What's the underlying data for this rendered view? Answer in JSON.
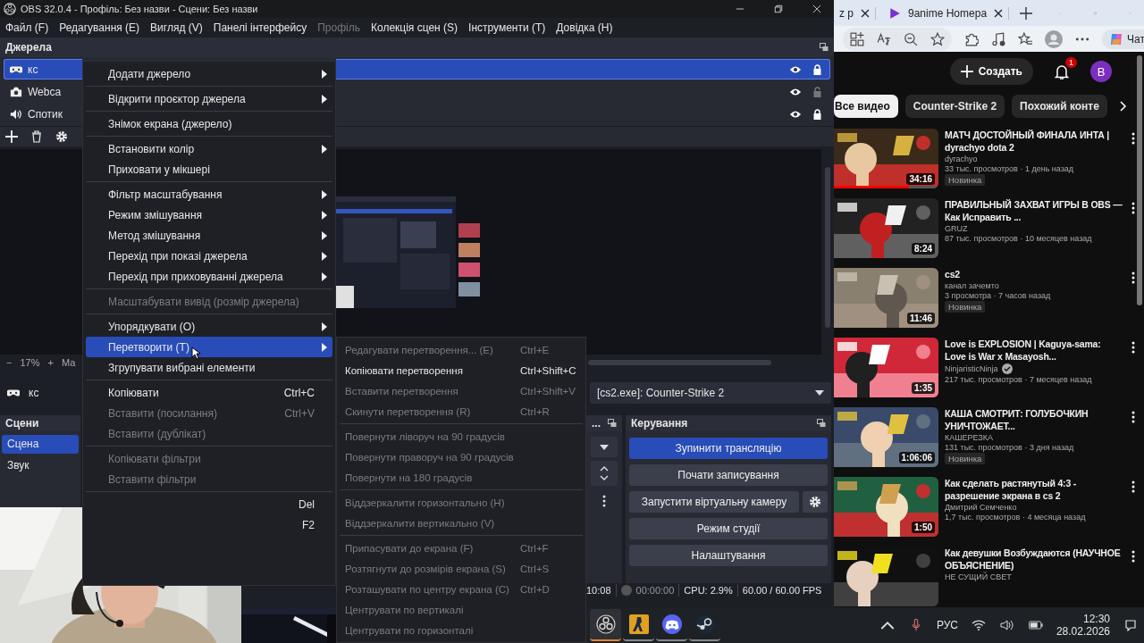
{
  "obs": {
    "title": "OBS 32.0.4 - Профіль: Без назви - Сцени: Без назви",
    "menubar": [
      {
        "label": "Файл (F)",
        "disabled": false
      },
      {
        "label": "Редагування (E)",
        "disabled": false
      },
      {
        "label": "Вигляд (V)",
        "disabled": false
      },
      {
        "label": "Панелі інтерфейсу",
        "disabled": false
      },
      {
        "label": "Профіль",
        "disabled": true
      },
      {
        "label": "Колекція сцен (S)",
        "disabled": false
      },
      {
        "label": "Інструменти (T)",
        "disabled": false
      },
      {
        "label": "Довідка (H)",
        "disabled": false
      }
    ],
    "sources": {
      "title": "Джерела",
      "items": [
        {
          "name": "кс",
          "kind": "game",
          "selected": true,
          "visible": true,
          "locked": true
        },
        {
          "name": "Webca",
          "kind": "camera",
          "selected": false,
          "visible": true,
          "locked": false
        },
        {
          "name": "Спотик",
          "kind": "audio",
          "selected": false,
          "visible": true,
          "locked": true
        }
      ]
    },
    "zoom": {
      "minus": "−",
      "value": "17%",
      "plus": "+",
      "label": "Ма"
    },
    "source_bar": {
      "name": "кс",
      "capture": "[cs2.exe]: Counter-Strike 2"
    },
    "scenes": {
      "title": "Сцени",
      "items": [
        {
          "label": "Сцена",
          "selected": true
        },
        {
          "label": "Звук",
          "selected": false
        }
      ]
    },
    "mid_dock": {
      "title": "..."
    },
    "controls": {
      "title": "Керування",
      "buttons": [
        {
          "label": "Зупинити трансляцію",
          "active": true,
          "settings": false
        },
        {
          "label": "Почати записування",
          "active": false,
          "settings": false
        },
        {
          "label": "Запустити віртуальну камеру",
          "active": false,
          "settings": true
        },
        {
          "label": "Режим студії",
          "active": false,
          "settings": false
        },
        {
          "label": "Налаштування",
          "active": false,
          "settings": false
        }
      ]
    },
    "status": {
      "time": "10:08",
      "rec_time": "00:00:00",
      "cpu": "CPU: 2.9%",
      "fps": "60.00 / 60.00 FPS"
    }
  },
  "context_menu": {
    "groups": [
      [
        {
          "label": "Додати джерело",
          "submenu": true,
          "disabled": false,
          "selected": false
        }
      ],
      [
        {
          "label": "Відкрити проєктор джерела",
          "submenu": true,
          "disabled": false,
          "selected": false
        }
      ],
      [
        {
          "label": "Знімок екрана (джерело)",
          "submenu": false,
          "disabled": false,
          "selected": false
        }
      ],
      [
        {
          "label": "Встановити колір",
          "submenu": true,
          "disabled": false,
          "selected": false
        },
        {
          "label": "Приховати у мікшері",
          "submenu": false,
          "disabled": false,
          "selected": false
        }
      ],
      [
        {
          "label": "Фільтр масштабування",
          "submenu": true,
          "disabled": false,
          "selected": false
        },
        {
          "label": "Режим змішування",
          "submenu": true,
          "disabled": false,
          "selected": false
        },
        {
          "label": "Метод змішування",
          "submenu": true,
          "disabled": false,
          "selected": false
        },
        {
          "label": "Перехід при показі джерела",
          "submenu": true,
          "disabled": false,
          "selected": false
        },
        {
          "label": "Перехід при приховуванні джерела",
          "submenu": true,
          "disabled": false,
          "selected": false
        }
      ],
      [
        {
          "label": "Масштабувати вивід (розмір джерела)",
          "submenu": false,
          "disabled": true,
          "selected": false
        }
      ],
      [
        {
          "label": "Упорядкувати (O)",
          "submenu": true,
          "disabled": false,
          "selected": false
        },
        {
          "label": "Перетворити (T)",
          "submenu": true,
          "disabled": false,
          "selected": true
        },
        {
          "label": "Згрупувати вибрані елементи",
          "submenu": false,
          "disabled": false,
          "selected": false
        }
      ],
      [
        {
          "label": "Копіювати",
          "shortcut": "Ctrl+C",
          "submenu": false,
          "disabled": false,
          "selected": false
        },
        {
          "label": "Вставити (посилання)",
          "shortcut": "Ctrl+V",
          "submenu": false,
          "disabled": true,
          "selected": false
        },
        {
          "label": "Вставити (дублікат)",
          "submenu": false,
          "disabled": true,
          "selected": false
        }
      ],
      [
        {
          "label": "Копіювати фільтри",
          "submenu": false,
          "disabled": true,
          "selected": false
        },
        {
          "label": "Вставити фільтри",
          "submenu": false,
          "disabled": true,
          "selected": false
        }
      ],
      [
        {
          "shortcut": "Del",
          "submenu": false,
          "disabled": false,
          "selected": false
        },
        {
          "shortcut": "F2",
          "submenu": false,
          "disabled": false,
          "selected": false
        }
      ]
    ]
  },
  "submenu": {
    "groups": [
      [
        {
          "label": "Редагувати перетворення... (E)",
          "shortcut": "Ctrl+E",
          "disabled": true
        },
        {
          "label": "Копіювати перетворення",
          "shortcut": "Ctrl+Shift+C",
          "disabled": false
        },
        {
          "label": "Вставити перетворення",
          "shortcut": "Ctrl+Shift+V",
          "disabled": true
        },
        {
          "label": "Скинути перетворення (R)",
          "shortcut": "Ctrl+R",
          "disabled": true
        }
      ],
      [
        {
          "label": "Повернути ліворуч на 90 градусів",
          "disabled": true
        },
        {
          "label": "Повернути праворуч на 90 градусів",
          "disabled": true
        },
        {
          "label": "Повернути на 180 градусів",
          "disabled": true
        }
      ],
      [
        {
          "label": "Віддзеркалити горизонтально (H)",
          "disabled": true
        },
        {
          "label": "Віддзеркалити вертикально (V)",
          "disabled": true
        }
      ],
      [
        {
          "label": "Припасувати до екрана (F)",
          "shortcut": "Ctrl+F",
          "disabled": true
        },
        {
          "label": "Розтягнути до розмірів екрана (S)",
          "shortcut": "Ctrl+S",
          "disabled": true
        },
        {
          "label": "Розташувати по центру екрана (C)",
          "shortcut": "Ctrl+D",
          "disabled": true
        },
        {
          "label": "Центрувати по вертикалі",
          "disabled": true
        },
        {
          "label": "Центрувати по горизонталі",
          "disabled": true
        }
      ]
    ]
  },
  "browser": {
    "tabs": [
      {
        "title": "z p",
        "favicon": false
      },
      {
        "title": "9anime Homepa",
        "favicon": true
      }
    ],
    "chat": "Чат",
    "create": "Создать",
    "notifications": "1",
    "avatar": "B",
    "chips": [
      {
        "label": "Все видео",
        "selected": true
      },
      {
        "label": "Counter-Strike 2",
        "selected": false
      },
      {
        "label": "Похожий конте",
        "selected": false
      }
    ],
    "videos": [
      {
        "title": "МАТЧ ДОСТОЙНЫЙ ФИНАЛА ИНТА | dyrachyo dota 2",
        "channel": "dyrachyo",
        "verified": false,
        "meta": "33 тыс. просмотров · 1 день назад",
        "badge": "Новинка",
        "duration": "34:16",
        "level": 0.72
      },
      {
        "title": "ПРАВИЛЬНЫЙ ЗАХВАТ ИГРЫ В OBS — Как Исправить ...",
        "channel": "GRUZ",
        "verified": false,
        "meta": "87 тыс. просмотров · 10 месяцев назад",
        "duration": "8:24"
      },
      {
        "title": "cs2",
        "channel": "канал зачемто",
        "verified": false,
        "meta": "3 просмотра · 7 часов назад",
        "badge": "Новинка",
        "duration": "11:46"
      },
      {
        "title": "Love is EXPLOSION | Kaguya-sama: Love is War x Masayosh...",
        "channel": "NinjaristicNinja",
        "verified": true,
        "meta": "217 тыс. просмотров · 7 месяцев назад",
        "duration": "1:35"
      },
      {
        "title": "КАША СМОТРИТ: ГОЛУБОЧКИН УНИЧТОЖАЕТ...",
        "channel": "КАШЕРЕЗКА",
        "verified": false,
        "meta": "131 тыс. просмотров · 3 дня назад",
        "badge": "Новинка",
        "duration": "1:06:06"
      },
      {
        "title": "Как сделать растянутый 4:3 - разрешение экрана в cs 2",
        "channel": "Дмитрий Семченко",
        "verified": false,
        "meta": "1,7 тыс. просмотров · 4 месяца назад",
        "duration": "1:50"
      },
      {
        "title": "Как девушки Возбуждаются (НАУЧНОЕ ОБЪЯСНЕНИЕ)",
        "channel": "НЕ СУЩИЙ СВЕТ",
        "verified": false
      }
    ]
  },
  "taskbar": {
    "apps": [
      {
        "kind": "obs",
        "active": true
      },
      {
        "kind": "cs",
        "active": false
      },
      {
        "kind": "discord",
        "active": false
      },
      {
        "kind": "steam",
        "active": false
      }
    ],
    "lang": "РУС",
    "time": "12:30",
    "date": "28.02.2026"
  }
}
